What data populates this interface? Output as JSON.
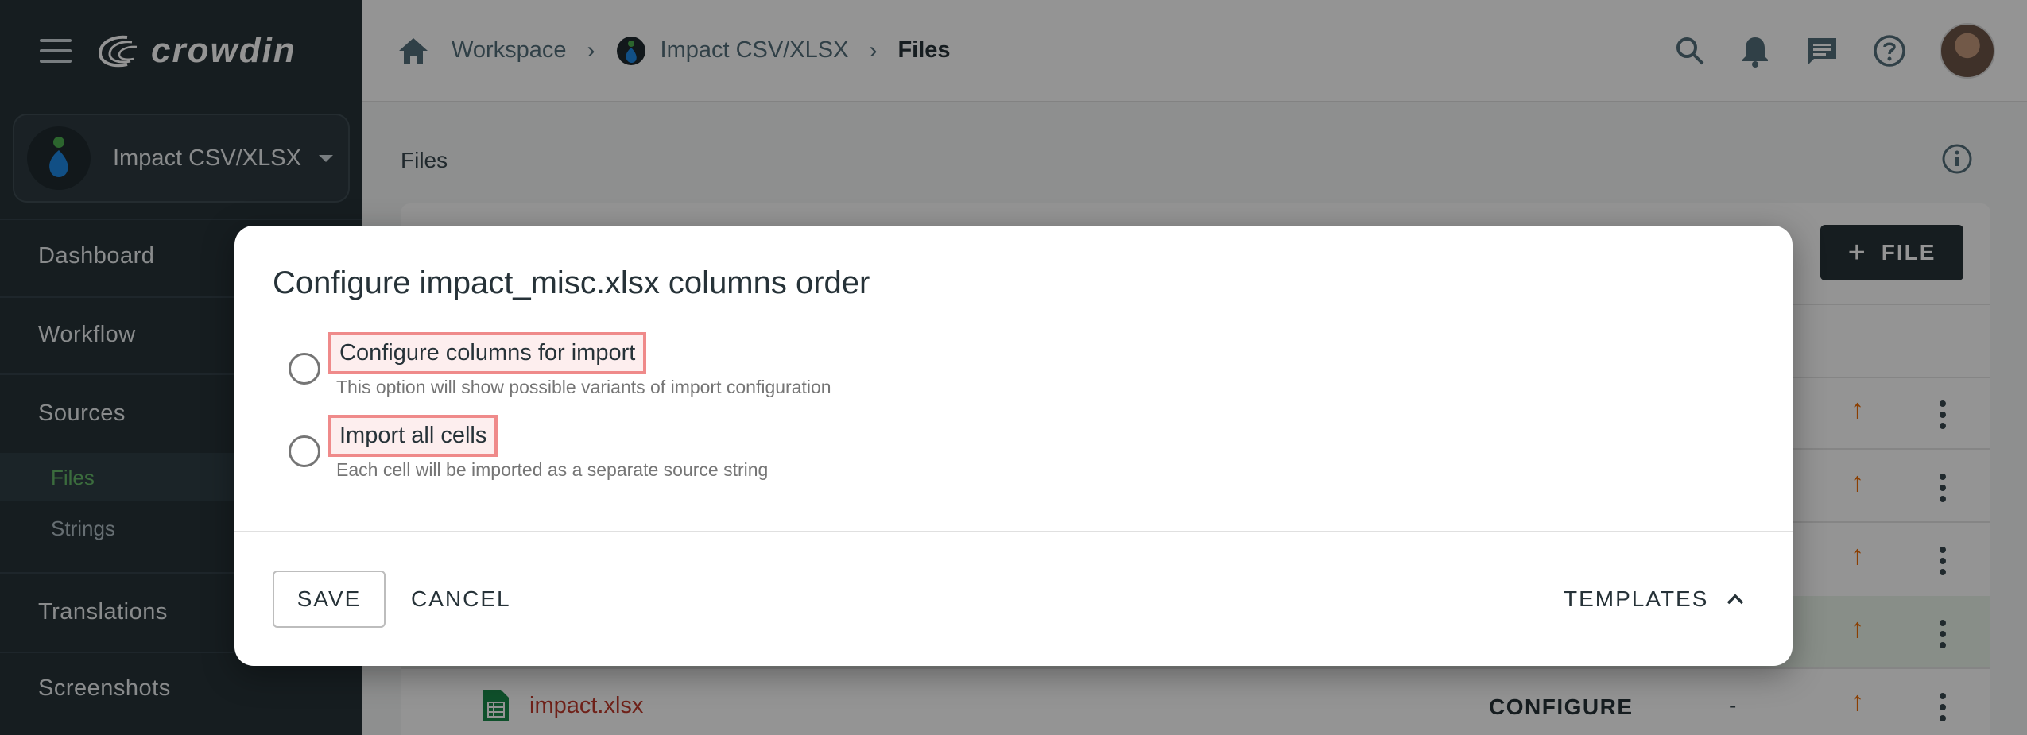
{
  "app": {
    "logo_text": "crowdin"
  },
  "project_selector": {
    "name": "Impact CSV/XLSX"
  },
  "sidebar": {
    "items": [
      {
        "label": "Dashboard"
      },
      {
        "label": "Workflow"
      },
      {
        "label": "Sources"
      },
      {
        "label": "Translations"
      },
      {
        "label": "Screenshots"
      }
    ],
    "sources_sub": [
      {
        "label": "Files",
        "active": true
      },
      {
        "label": "Strings",
        "active": false
      }
    ]
  },
  "breadcrumb": {
    "items": [
      "Workspace",
      "Impact CSV/XLSX",
      "Files"
    ]
  },
  "topbar_icons": [
    "search-icon",
    "bell-icon",
    "chat-icon",
    "help-icon",
    "avatar"
  ],
  "main": {
    "title": "Files",
    "add_file_label": "FILE",
    "file_row": {
      "name": "impact.xlsx",
      "action": "CONFIGURE",
      "progress": "-"
    }
  },
  "modal": {
    "title": "Configure impact_misc.xlsx columns order",
    "options": [
      {
        "label": "Configure columns for import",
        "description": "This option will show possible variants of import configuration"
      },
      {
        "label": "Import all cells",
        "description": "Each cell will be imported as a separate source string"
      }
    ],
    "save_label": "SAVE",
    "cancel_label": "CANCEL",
    "templates_label": "TEMPLATES"
  },
  "colors": {
    "sidebar_bg": "#263238",
    "accent_green": "#66bb6a",
    "upload_arrow": "#ef6c00",
    "highlight_border": "#ef8a8a"
  }
}
